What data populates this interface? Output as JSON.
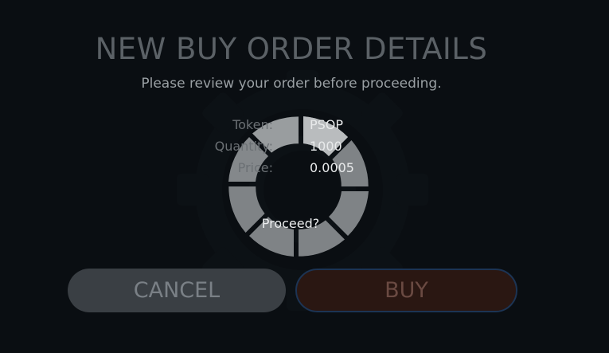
{
  "dialog": {
    "title": "NEW BUY ORDER DETAILS",
    "subtitle": "Please review your order before proceeding.",
    "fields": [
      {
        "label": "Token:",
        "value": "PSOP"
      },
      {
        "label": "Quantity:",
        "value": "1000"
      },
      {
        "label": "Price:",
        "value": "0.0005"
      }
    ],
    "prompt": "Proceed?",
    "cancel_label": "CANCEL",
    "buy_label": "BUY"
  },
  "icons": {
    "background": "gear-icon",
    "loading": "loading-spinner-icon"
  },
  "colors": {
    "background": "#0a0e12",
    "cancel_button": "#3a3f44",
    "buy_button": "#2a1712",
    "buy_border": "#1c3454"
  }
}
